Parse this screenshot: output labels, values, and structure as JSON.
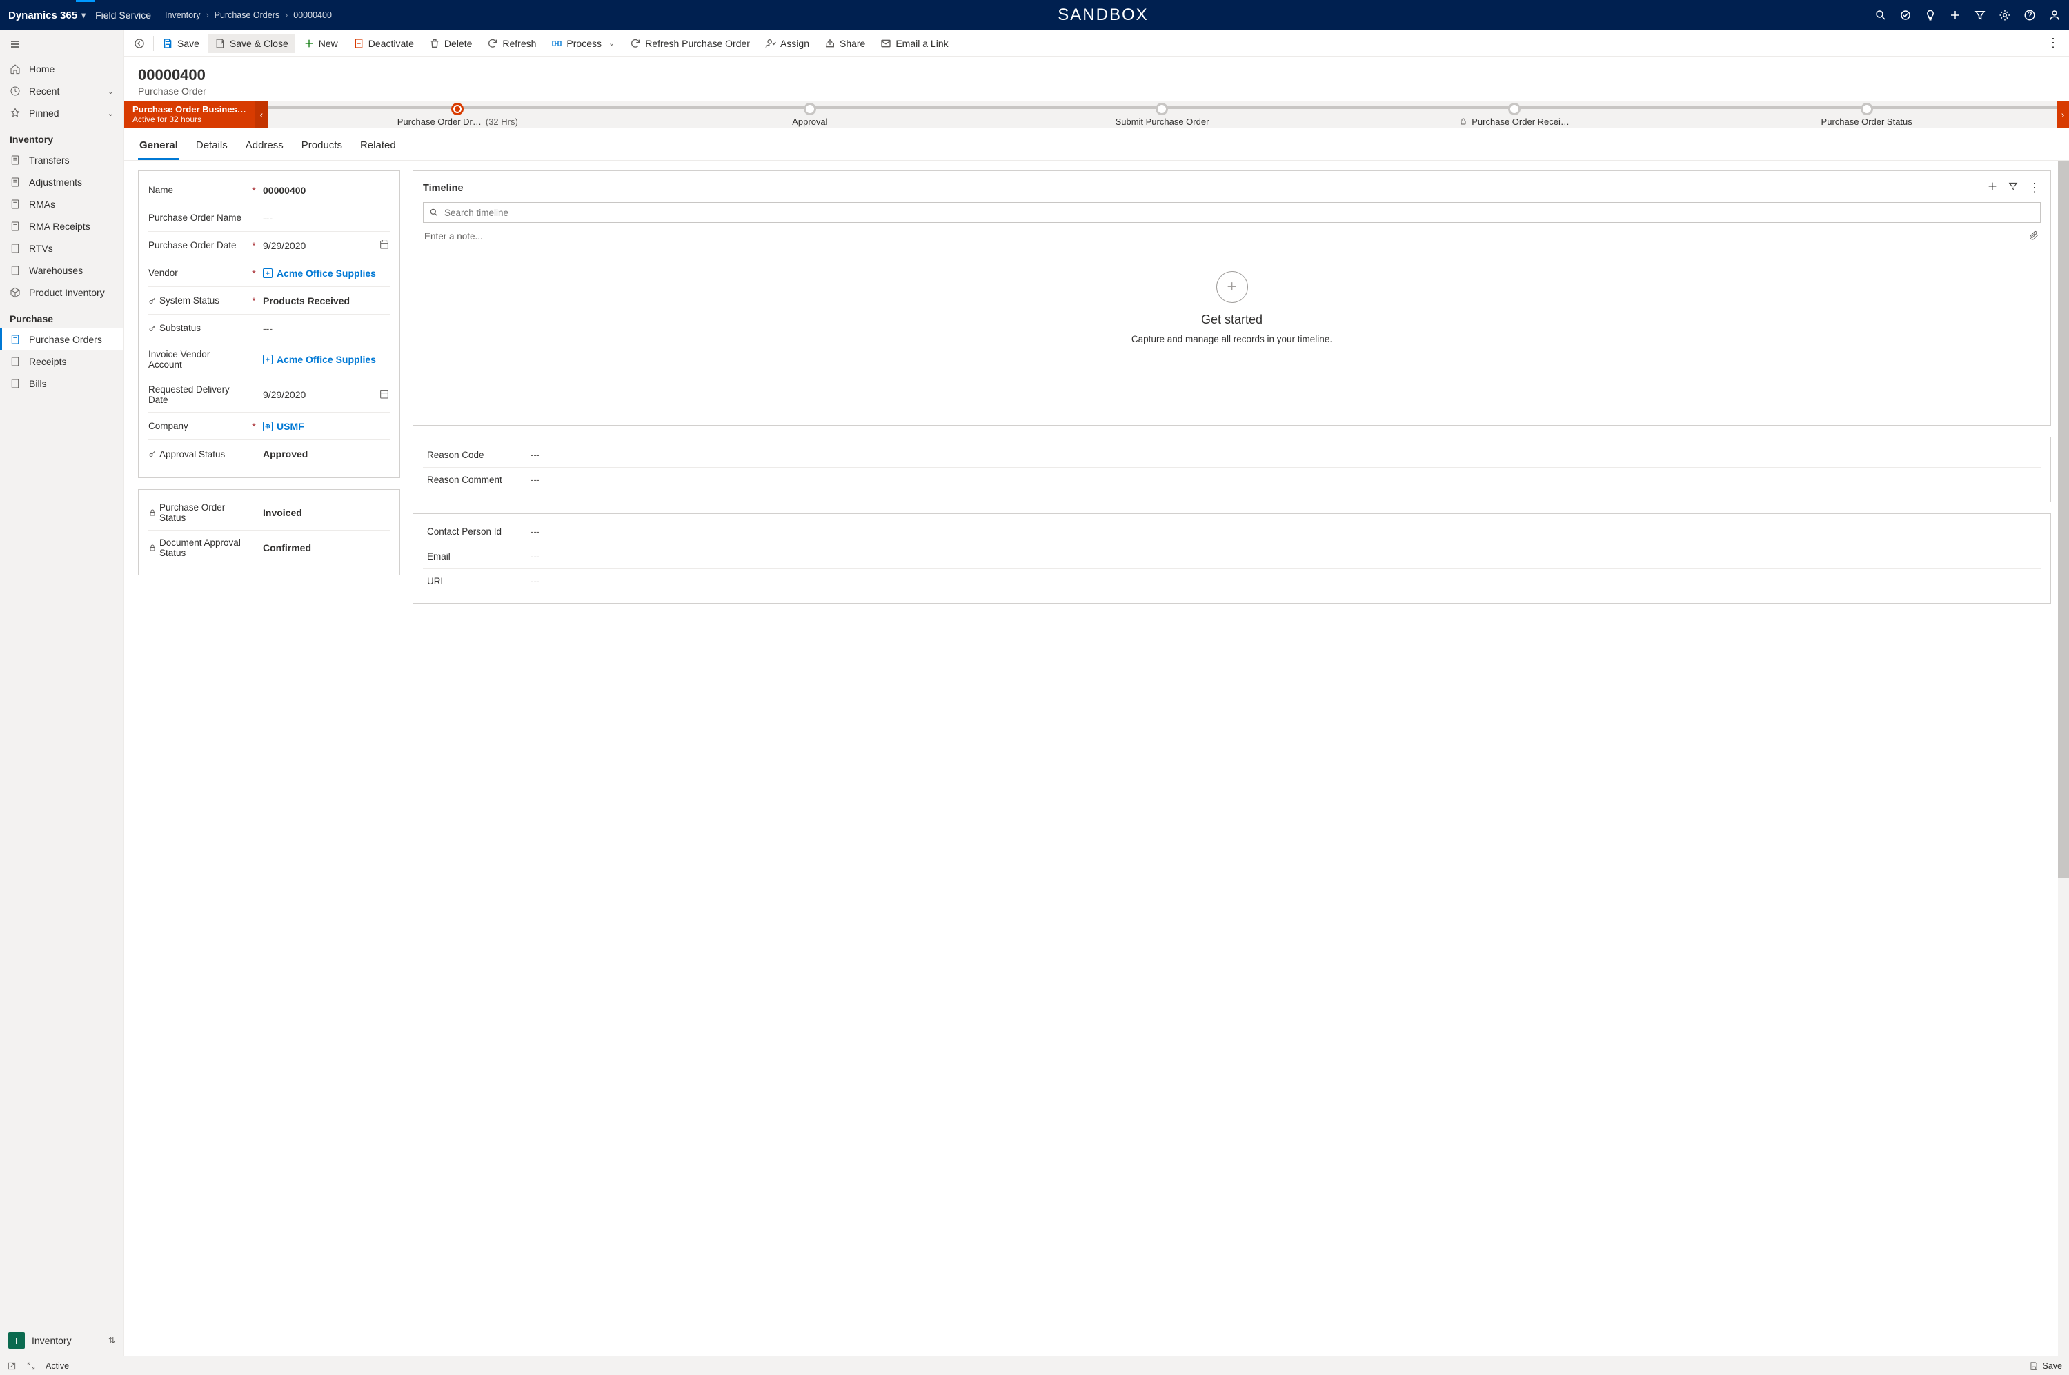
{
  "topbar": {
    "brand": "Dynamics 365",
    "app": "Field Service",
    "env_label": "SANDBOX",
    "breadcrumb": [
      "Inventory",
      "Purchase Orders",
      "00000400"
    ]
  },
  "sidebar": {
    "quick": [
      {
        "label": "Home",
        "icon": "home"
      },
      {
        "label": "Recent",
        "icon": "clock",
        "expandable": true
      },
      {
        "label": "Pinned",
        "icon": "pin",
        "expandable": true
      }
    ],
    "groups": [
      {
        "title": "Inventory",
        "items": [
          {
            "label": "Transfers",
            "icon": "doc"
          },
          {
            "label": "Adjustments",
            "icon": "doc"
          },
          {
            "label": "RMAs",
            "icon": "doc"
          },
          {
            "label": "RMA Receipts",
            "icon": "doc"
          },
          {
            "label": "RTVs",
            "icon": "doc"
          },
          {
            "label": "Warehouses",
            "icon": "doc"
          },
          {
            "label": "Product Inventory",
            "icon": "box"
          }
        ]
      },
      {
        "title": "Purchase",
        "items": [
          {
            "label": "Purchase Orders",
            "icon": "doc",
            "selected": true
          },
          {
            "label": "Receipts",
            "icon": "doc"
          },
          {
            "label": "Bills",
            "icon": "doc"
          }
        ]
      }
    ],
    "switcher": {
      "badge": "I",
      "label": "Inventory"
    }
  },
  "cmdbar": {
    "save": "Save",
    "save_close": "Save & Close",
    "new": "New",
    "deactivate": "Deactivate",
    "delete": "Delete",
    "refresh": "Refresh",
    "process": "Process",
    "refresh_po": "Refresh Purchase Order",
    "assign": "Assign",
    "share": "Share",
    "email_link": "Email a Link"
  },
  "record": {
    "title": "00000400",
    "subtitle": "Purchase Order"
  },
  "bpf": {
    "name_line1": "Purchase Order Business …",
    "name_line2": "Active for 32 hours",
    "stages": [
      {
        "label": "Purchase Order Dr…",
        "duration": "(32 Hrs)",
        "active": true
      },
      {
        "label": "Approval"
      },
      {
        "label": "Submit Purchase Order"
      },
      {
        "label": "Purchase Order Recei…",
        "locked": true
      },
      {
        "label": "Purchase Order Status"
      }
    ]
  },
  "tabs": [
    "General",
    "Details",
    "Address",
    "Products",
    "Related"
  ],
  "active_tab": "General",
  "form": {
    "name": {
      "label": "Name",
      "value": "00000400",
      "required": true
    },
    "po_name": {
      "label": "Purchase Order Name",
      "value": "---"
    },
    "po_date": {
      "label": "Purchase Order Date",
      "value": "9/29/2020",
      "required": true
    },
    "vendor": {
      "label": "Vendor",
      "value": "Acme Office Supplies",
      "lookup": true,
      "required": true
    },
    "system_status": {
      "label": "System Status",
      "value": "Products Received",
      "required": true,
      "key": true
    },
    "substatus": {
      "label": "Substatus",
      "value": "---",
      "key": true
    },
    "invoice_vendor": {
      "label": "Invoice Vendor Account",
      "value": "Acme Office Supplies",
      "lookup": true
    },
    "req_delivery": {
      "label": "Requested Delivery Date",
      "value": "9/29/2020"
    },
    "company": {
      "label": "Company",
      "value": "USMF",
      "lookup": true,
      "required": true
    },
    "approval_status": {
      "label": "Approval Status",
      "value": "Approved",
      "key": true
    },
    "po_status": {
      "label": "Purchase Order Status",
      "value": "Invoiced",
      "locked": true
    },
    "doc_approval": {
      "label": "Document Approval Status",
      "value": "Confirmed",
      "locked": true
    }
  },
  "timeline": {
    "title": "Timeline",
    "search_placeholder": "Search timeline",
    "note_placeholder": "Enter a note...",
    "empty_heading": "Get started",
    "empty_text": "Capture and manage all records in your timeline."
  },
  "right_cards": {
    "reason_code": {
      "label": "Reason Code",
      "value": "---"
    },
    "reason_comment": {
      "label": "Reason Comment",
      "value": "---"
    },
    "contact_person": {
      "label": "Contact Person Id",
      "value": "---"
    },
    "email": {
      "label": "Email",
      "value": "---"
    },
    "url": {
      "label": "URL",
      "value": "---"
    }
  },
  "statusbar": {
    "status": "Active",
    "save": "Save"
  }
}
